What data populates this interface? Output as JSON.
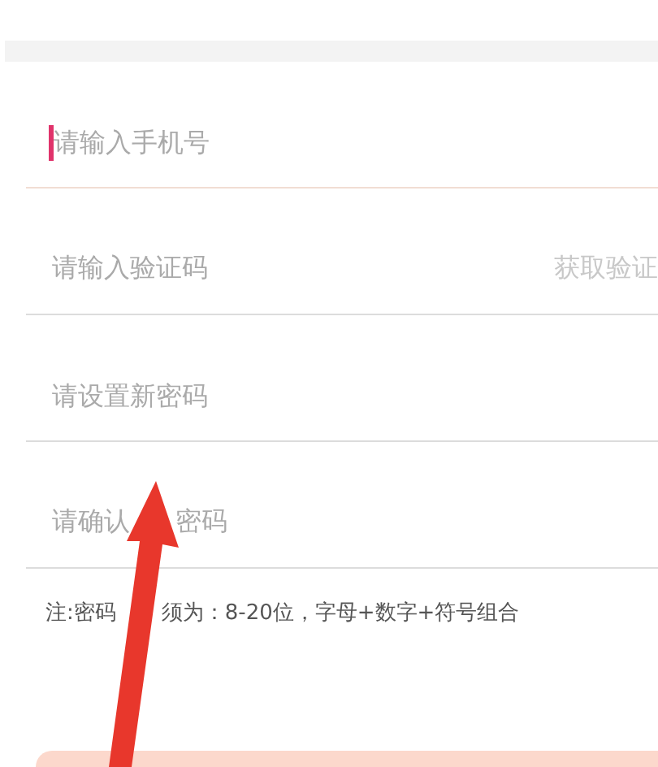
{
  "fields": [
    {
      "placeholder": "请输入手机号",
      "focused": true
    },
    {
      "placeholder": "请输入验证码",
      "focused": false,
      "action": "获取验证"
    },
    {
      "placeholder": "请设置新密码",
      "focused": false
    },
    {
      "placeholder": "请确认",
      "focused": false,
      "placeholder_rest": "密码"
    }
  ],
  "note": "注:密码",
  "note_rest": "须为：8-20位，字母+数字+符号组合"
}
